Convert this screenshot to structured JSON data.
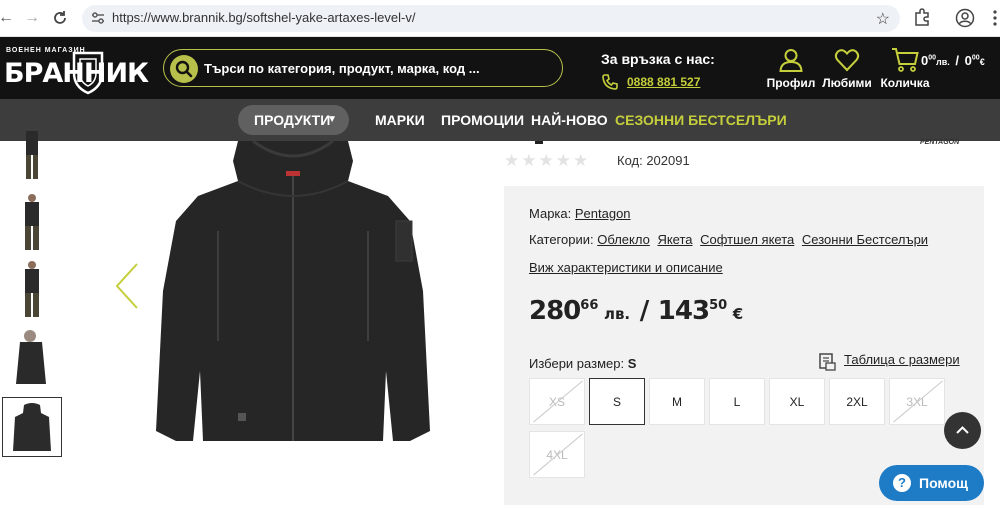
{
  "browser": {
    "url": "https://www.brannik.bg/softshel-yake-artaxes-level-v/"
  },
  "header": {
    "logo_small": "ВОЕНЕН МАГАЗИН",
    "logo_main": "БРАННИК",
    "search_placeholder": "Търси по категория, продукт, марка, код ...",
    "contact_title": "За връзка с нас:",
    "phone": "0888 881 527",
    "profile_label": "Профил",
    "favorites_label": "Любими",
    "cart_label": "Количка",
    "cart_total_bgn": "0",
    "cart_total_bgn_dec": "00",
    "cart_total_bgn_unit": "лв.",
    "cart_total_eur": "0",
    "cart_total_eur_dec": "00",
    "cart_total_eur_unit": "€",
    "cart_total_sep": "/"
  },
  "nav": {
    "products": "ПРОДУКТИ",
    "brands": "МАРКИ",
    "promotions": "ПРОМОЦИИ",
    "newest": "НАЙ-НОВО",
    "seasonal": "СЕЗОННИ БЕСТСЕЛЪРИ"
  },
  "product": {
    "code_label": "Код: 202091",
    "rating_stars": 0,
    "brand_logo_text": "PENTAGON",
    "brand_label": "Марка:",
    "brand": "Pentagon",
    "categories_label": "Категории:",
    "categories": [
      "Облекло",
      "Якета",
      "Софтшел якета",
      "Сезонни Бестселъри"
    ],
    "details_link": "Виж характеристики и описание",
    "price_bgn": "280",
    "price_bgn_dec": "66",
    "price_bgn_unit": "лв.",
    "price_sep": "/",
    "price_eur": "143",
    "price_eur_dec": "50",
    "price_eur_unit": "€",
    "size_label": "Избери размер:",
    "selected_size": "S",
    "size_chart_link": "Таблица с размери",
    "sizes": [
      "XS",
      "S",
      "M",
      "L",
      "XL",
      "2XL",
      "3XL",
      "4XL"
    ]
  },
  "help": {
    "label": "Помощ",
    "icon": "?"
  },
  "colors": {
    "accent": "#c5cf3c",
    "header_bg": "#121212",
    "nav_bg": "#3d3d3d",
    "help_blue": "#1e7cc7"
  }
}
